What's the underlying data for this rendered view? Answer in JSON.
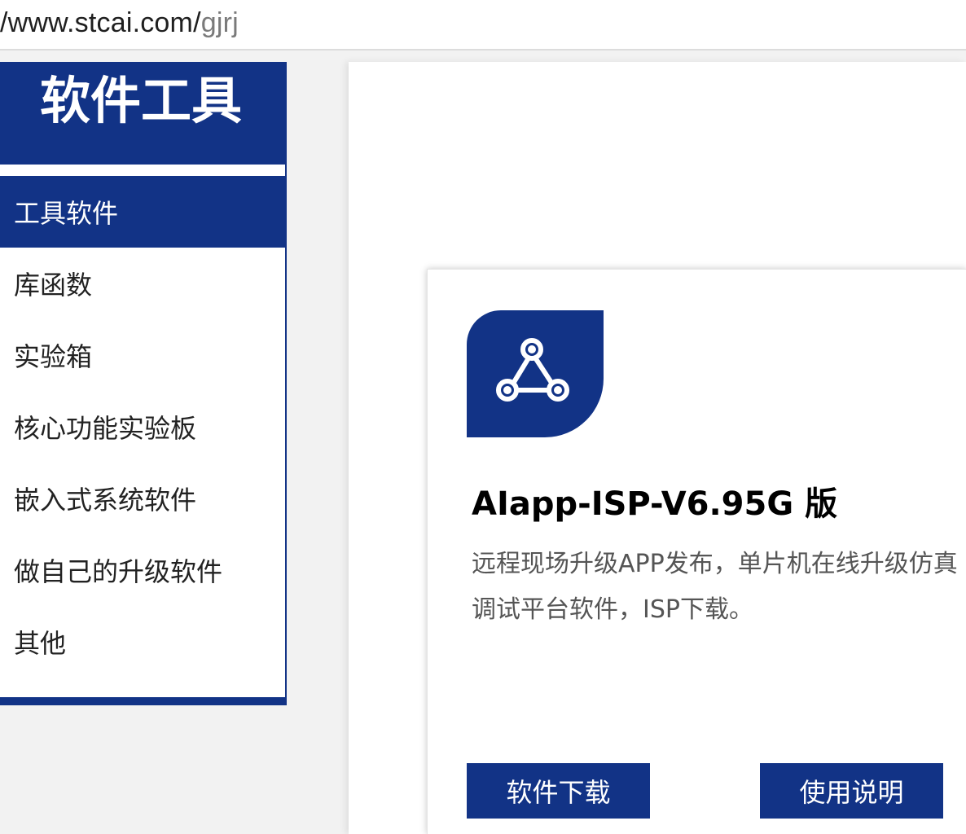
{
  "browser": {
    "url_host": "/www.stcai.com/",
    "url_path": "gjrj"
  },
  "sidebar": {
    "title": "软件工具",
    "items": [
      {
        "label": "工具软件",
        "active": true
      },
      {
        "label": "库函数",
        "active": false
      },
      {
        "label": "实验箱",
        "active": false
      },
      {
        "label": "核心功能实验板",
        "active": false
      },
      {
        "label": "嵌入式系统软件",
        "active": false
      },
      {
        "label": "做自己的升级软件",
        "active": false
      },
      {
        "label": "其他",
        "active": false
      }
    ]
  },
  "card": {
    "icon": "share-nodes-icon",
    "title": "AIapp-ISP-V6.95G 版",
    "description": "远程现场升级APP发布，单片机在线升级仿真调试平台软件，ISP下载。",
    "download_label": "软件下载",
    "manual_label": "使用说明"
  },
  "colors": {
    "brand": "#123386",
    "page_bg": "#f2f2f2"
  }
}
